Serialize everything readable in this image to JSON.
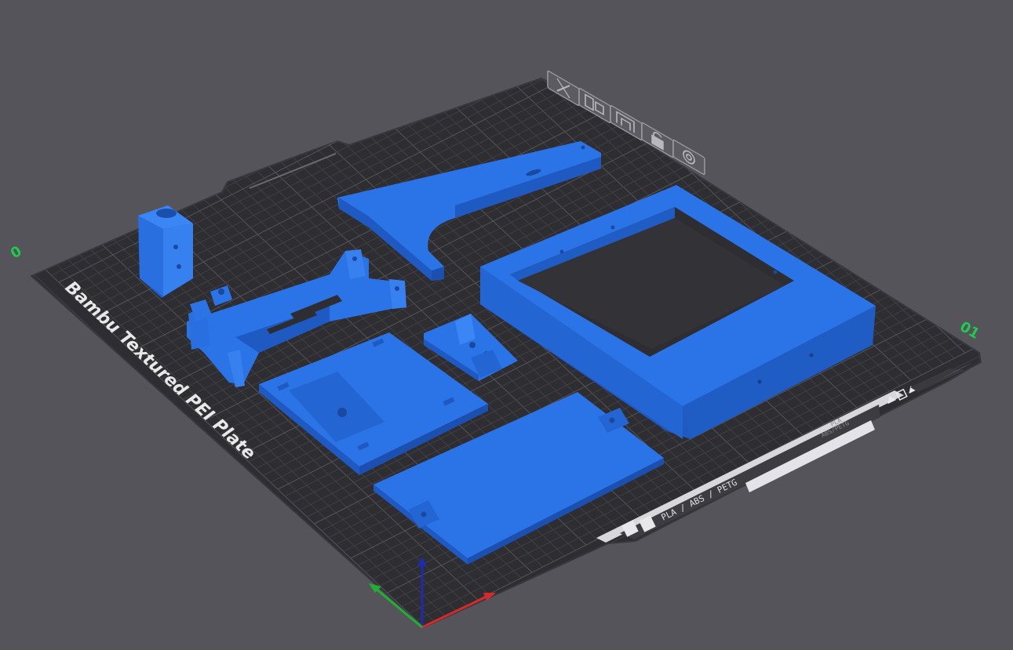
{
  "plate": {
    "label": "Bambu Textured PEI Plate",
    "materials": "PLA / ABS / PETG",
    "small_label_line1": "PLA",
    "small_label_line2": "ABS/PETG"
  },
  "axis_labels": {
    "left_marker": "0",
    "right_marker": "01"
  },
  "toolbar": {
    "items": [
      {
        "name": "delete-plate",
        "icon": "close-icon"
      },
      {
        "name": "arrange",
        "icon": "arrange-icon"
      },
      {
        "name": "orient",
        "icon": "orient-icon"
      },
      {
        "name": "lock",
        "icon": "lock-icon"
      },
      {
        "name": "plate-settings",
        "icon": "gear-icon"
      }
    ]
  },
  "colors": {
    "background": "#55545a",
    "plate": "#2e2d31",
    "grid": "#4a494e",
    "part": "#2872e6",
    "axis_x": "#d62a2a",
    "axis_y": "#1fb033",
    "axis_z": "#1d2bb3",
    "accent_green": "#1ecb4f"
  }
}
